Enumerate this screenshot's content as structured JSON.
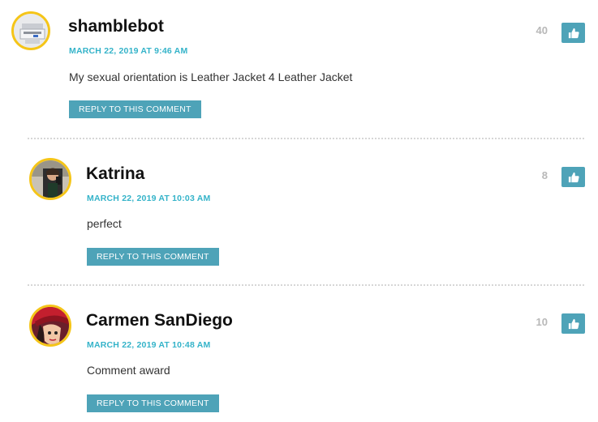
{
  "comments": [
    {
      "author": "shamblebot",
      "date": "MARCH 22, 2019 AT 9:46 AM",
      "text": "My sexual orientation is Leather Jacket 4 Leather Jacket",
      "reply_label": "REPLY TO THIS COMMENT",
      "votes": "40",
      "avatar_icon": "printer-avatar-icon"
    },
    {
      "author": "Katrina",
      "date": "MARCH 22, 2019 AT 10:03 AM",
      "text": "perfect",
      "reply_label": "REPLY TO THIS COMMENT",
      "votes": "8",
      "avatar_icon": "selfie-avatar-icon"
    },
    {
      "author": "Carmen SanDiego",
      "date": "MARCH 22, 2019 AT 10:48 AM",
      "text": "Comment award",
      "reply_label": "REPLY TO THIS COMMENT",
      "votes": "10",
      "avatar_icon": "carmen-avatar-icon"
    }
  ],
  "colors": {
    "accent": "#4ea3b8",
    "date": "#34b3c9",
    "avatar_border": "#f5c518",
    "votes": "#b8b8b8"
  }
}
